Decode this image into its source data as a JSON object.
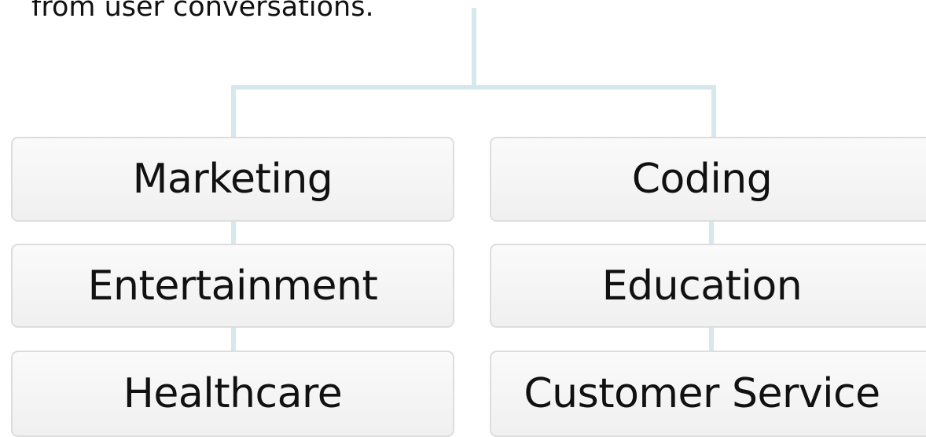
{
  "caption": "from user conversations.",
  "categories": {
    "left": [
      "Marketing",
      "Entertainment",
      "Healthcare"
    ],
    "right": [
      "Coding",
      "Education",
      "Customer Service"
    ]
  },
  "colors": {
    "connector": "#d6e8ee",
    "box_border": "#dddddd",
    "box_fill": "#f4f4f4",
    "text": "#111111"
  }
}
